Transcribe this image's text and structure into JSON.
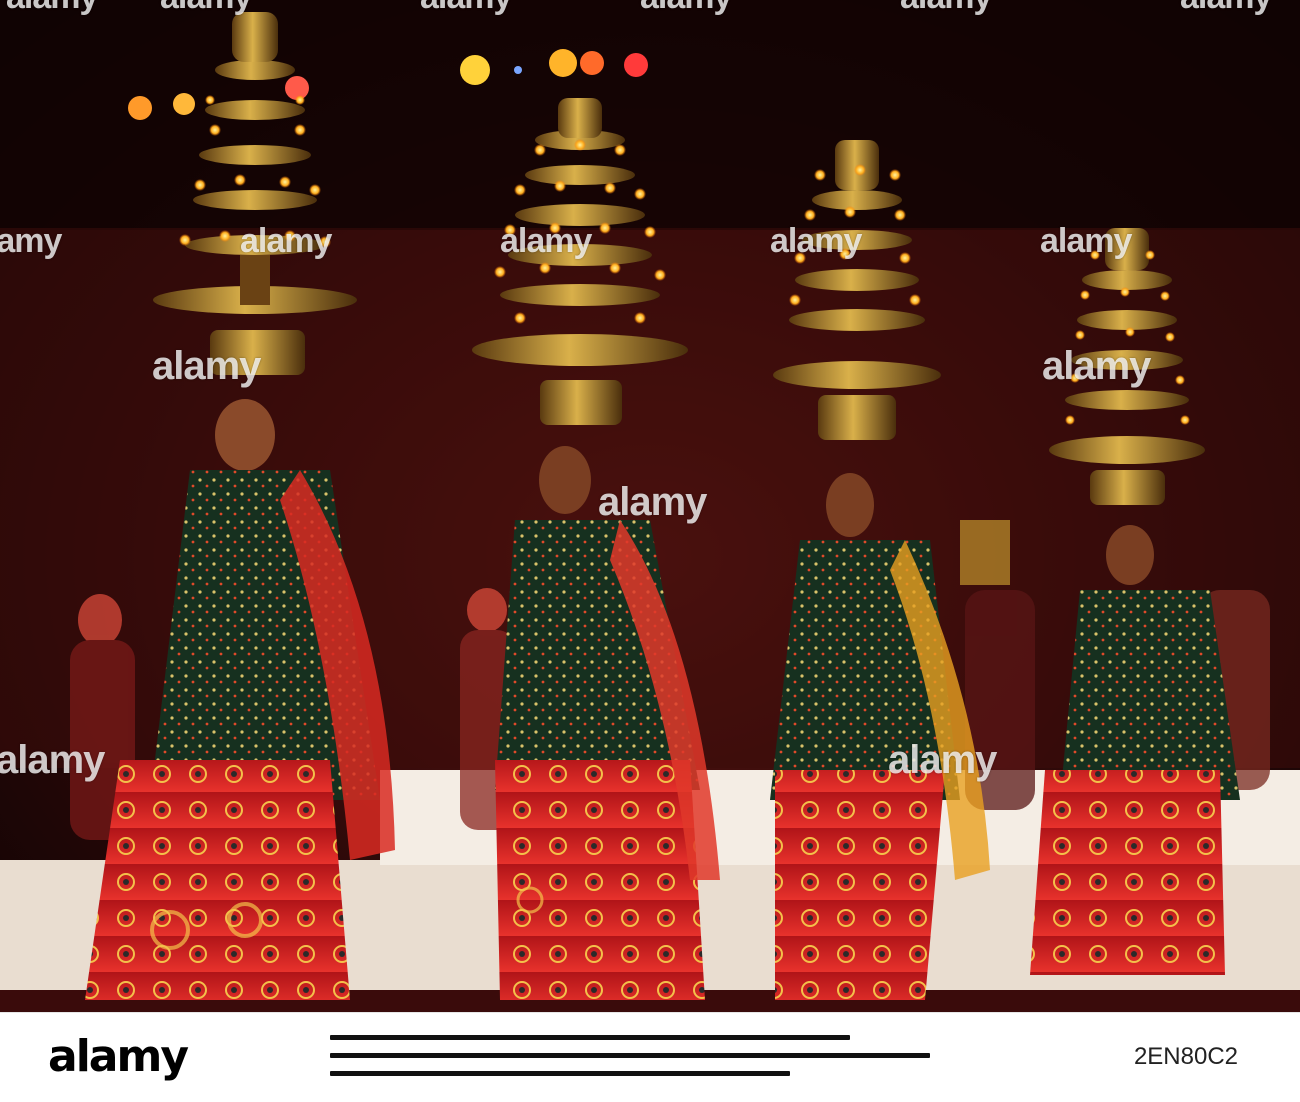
{
  "photo": {
    "subject": "",
    "colors": {
      "background": "#1a0607",
      "backdrop_red": "#4a0f10",
      "brass": "#c9a038",
      "flame": "#ffd36a",
      "skirt_red": "#d81f24",
      "shawl_green": "#1f3b2a",
      "floor": "#f1e8de"
    }
  },
  "watermark": {
    "text": "alamy",
    "positions_note": ""
  },
  "footer": {
    "logo": "alamy",
    "image_id": "2EN80C2"
  }
}
